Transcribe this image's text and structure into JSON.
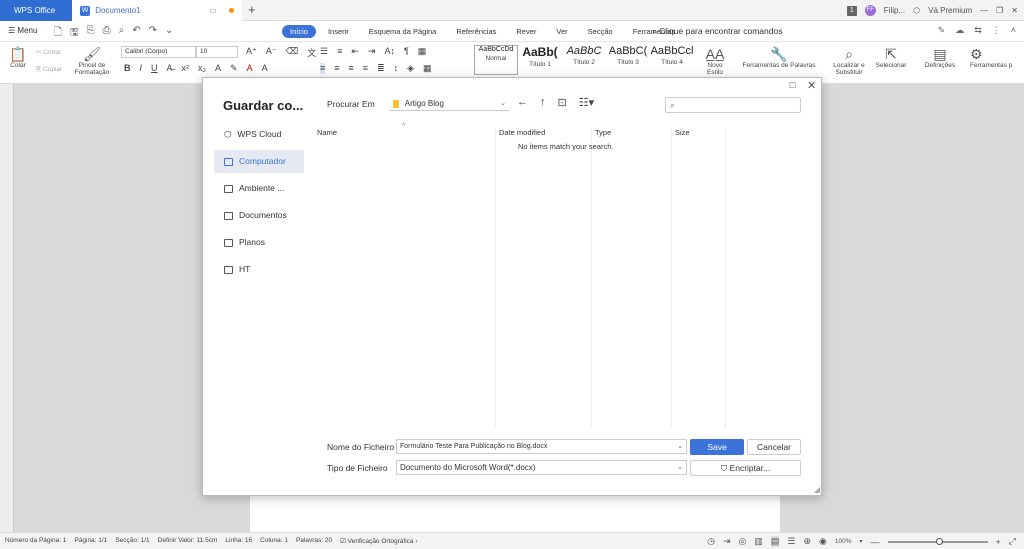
{
  "titlebar": {
    "app_tab": "WPS Office",
    "doc_tab": "Documento1",
    "user": "Filip...",
    "premium": "Vá Premium",
    "notif_count": "1"
  },
  "menubar": {
    "menu_label": "Menu",
    "tabs": [
      "Início",
      "Inserir",
      "Esquema da Página",
      "Referências",
      "Rever",
      "Ver",
      "Secção",
      "Ferramentas"
    ],
    "search_cmd": "Clique para encontrar comandos"
  },
  "ribbon": {
    "paste": "Colar",
    "cut": "Cortar",
    "copy": "Copiar",
    "format_painter": "Pincel de Formatação",
    "font": "Calibri (Corpo)",
    "size": "10",
    "styles": [
      {
        "preview": "AaBbCcDd",
        "name": "Normal"
      },
      {
        "preview": "AaBb(",
        "name": "Título 1"
      },
      {
        "preview": "AaBbC",
        "name": "Título 2"
      },
      {
        "preview": "AaBbC(",
        "name": "Título 3"
      },
      {
        "preview": "AaBbCcl",
        "name": "Título 4"
      }
    ],
    "new_style": "Novo Estilo",
    "word_tools": "Ferramentas de Palavras",
    "find_replace": "Localizar e Substituir",
    "select": "Selecionar",
    "settings": "Definições",
    "tools": "Ferramentas p"
  },
  "dialog": {
    "title": "Guardar co...",
    "look_in_label": "Procurar Em",
    "look_in_value": "Artigo Blog",
    "sidebar": [
      {
        "label": "WPS Cloud",
        "active": false
      },
      {
        "label": "Computador",
        "active": true
      },
      {
        "label": "Ambiente ...",
        "active": false
      },
      {
        "label": "Documentos",
        "active": false
      },
      {
        "label": "Planos",
        "active": false
      },
      {
        "label": "HT",
        "active": false
      }
    ],
    "columns": {
      "name": "Name",
      "date": "Date modified",
      "type": "Type",
      "size": "Size"
    },
    "empty_message": "No items match your search.",
    "filename_label": "Nome do Ficheiro",
    "filename_value": "Formulário Teste Para Publicação no Blog.docx",
    "filetype_label": "Tipo de Ficheiro",
    "filetype_value": "Documento do Microsoft Word(*.docx)",
    "save_button": "Save",
    "cancel_button": "Cancelar",
    "encrypt_button": "Encriptar..."
  },
  "statusbar": {
    "page_num": "Número da Página: 1",
    "pages": "Página: 1/1",
    "section": "Secção: 1/1",
    "set_value": "Definir Valor: 11.5cm",
    "line": "Linha: 16",
    "column": "Coluna: 1",
    "words": "Palavras: 20",
    "spell_check": "Verificação Ortográfica",
    "zoom": "100%"
  }
}
